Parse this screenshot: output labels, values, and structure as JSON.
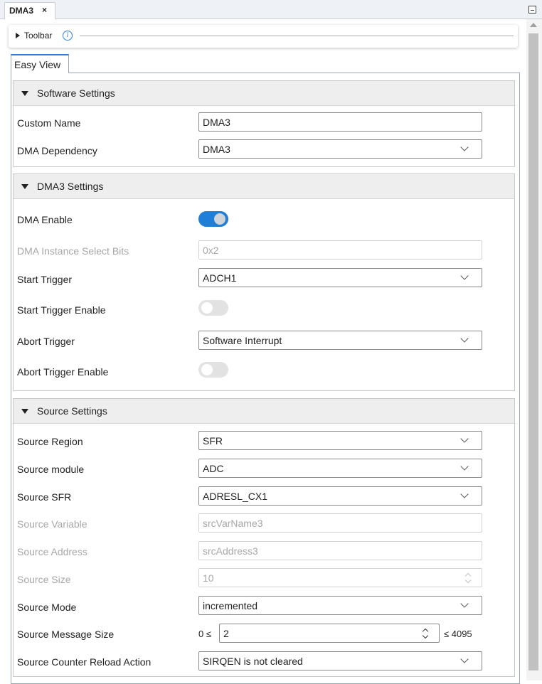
{
  "window": {
    "tab_title": "DMA3",
    "tab_close": "×"
  },
  "toolbar": {
    "label": "Toolbar",
    "info_glyph": "i"
  },
  "view_tab": {
    "label": "Easy View"
  },
  "software_settings": {
    "title": "Software Settings",
    "custom_name": {
      "label": "Custom Name",
      "value": "DMA3"
    },
    "dma_dependency": {
      "label": "DMA Dependency",
      "value": "DMA3"
    }
  },
  "dma3_settings": {
    "title": "DMA3 Settings",
    "dma_enable": {
      "label": "DMA Enable",
      "checked": true
    },
    "instance_select": {
      "label": "DMA Instance Select Bits",
      "value": "0x2"
    },
    "start_trigger": {
      "label": "Start Trigger",
      "value": "ADCH1"
    },
    "start_trigger_enable": {
      "label": "Start Trigger Enable",
      "checked": false
    },
    "abort_trigger": {
      "label": "Abort Trigger",
      "value": "Software Interrupt"
    },
    "abort_trigger_enable": {
      "label": "Abort Trigger Enable",
      "checked": false
    }
  },
  "source_settings": {
    "title": "Source Settings",
    "source_region": {
      "label": "Source Region",
      "value": "SFR"
    },
    "source_module": {
      "label": "Source module",
      "value": "ADC"
    },
    "source_sfr": {
      "label": "Source SFR",
      "value": "ADRESL_CX1"
    },
    "source_variable": {
      "label": "Source Variable",
      "value": "srcVarName3"
    },
    "source_address": {
      "label": "Source Address",
      "value": "srcAddress3"
    },
    "source_size": {
      "label": "Source Size",
      "value": "10"
    },
    "source_mode": {
      "label": "Source Mode",
      "value": "incremented"
    },
    "source_message_size": {
      "label": "Source Message Size",
      "min_text": "0 ≤",
      "value": "2",
      "max_text": "≤ 4095"
    },
    "reload_action": {
      "label": "Source Counter Reload Action",
      "value": "SIRQEN is not cleared"
    }
  }
}
